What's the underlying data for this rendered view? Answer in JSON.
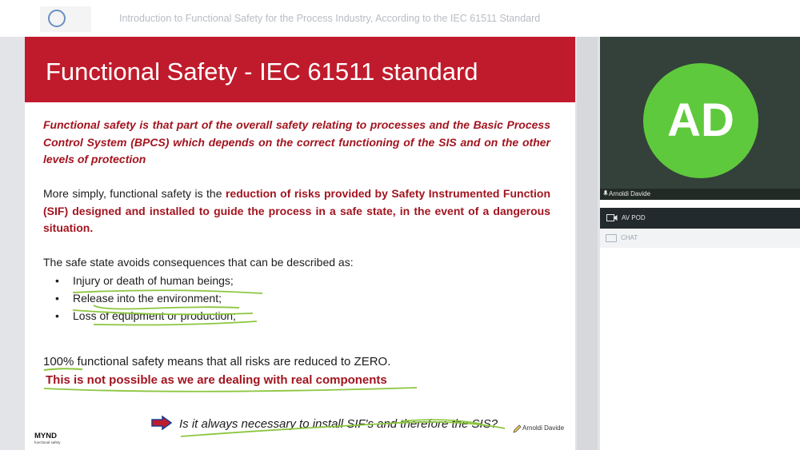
{
  "header": {
    "title": "Introduction to Functional Safety for the Process Industry, According to the IEC 61511 Standard",
    "logo_icon": "organization-logo-icon"
  },
  "slide": {
    "title": "Functional Safety - IEC 61511 standard",
    "definition": "Functional safety is that part of the overall safety relating to processes and the Basic Process Control System (BPCS) which depends on the correct functioning of the SIS and on the other levels of protection",
    "simply_lead": "More simply, functional safety is the ",
    "simply_highlight": "reduction of risks provided by Safety Instrumented Function (SIF) designed and installed to guide the process in a safe state, in the event of a dangerous situation.",
    "safe_state_intro": "The safe state avoids consequences that can be described as:",
    "bullets": [
      "Injury or death of human beings;",
      "Release into the environment;",
      "Loss of equipment or production;"
    ],
    "zero_risk": "100% functional safety means that all risks are reduced to ZERO.",
    "not_possible": "This is not possible as we are dealing with real components",
    "question": "Is it always necessary to install SIF's and therefore the SIS?",
    "annotation_user": "Arnoldi Davide",
    "footer_brand": "MYND",
    "footer_brand_sub": "functional safety",
    "colors": {
      "header_red": "#c01b2c",
      "emphasis_red": "#a3141f",
      "annotation_green": "#8cc63f"
    }
  },
  "sidebar": {
    "participant": {
      "initials": "AD",
      "name": "Arnoldi Davide",
      "avatar_color": "#5fc93d"
    },
    "pods": [
      {
        "label": "AV POD",
        "icon": "video-camera-icon"
      },
      {
        "label": "CHAT",
        "icon": "chat-icon"
      }
    ]
  }
}
